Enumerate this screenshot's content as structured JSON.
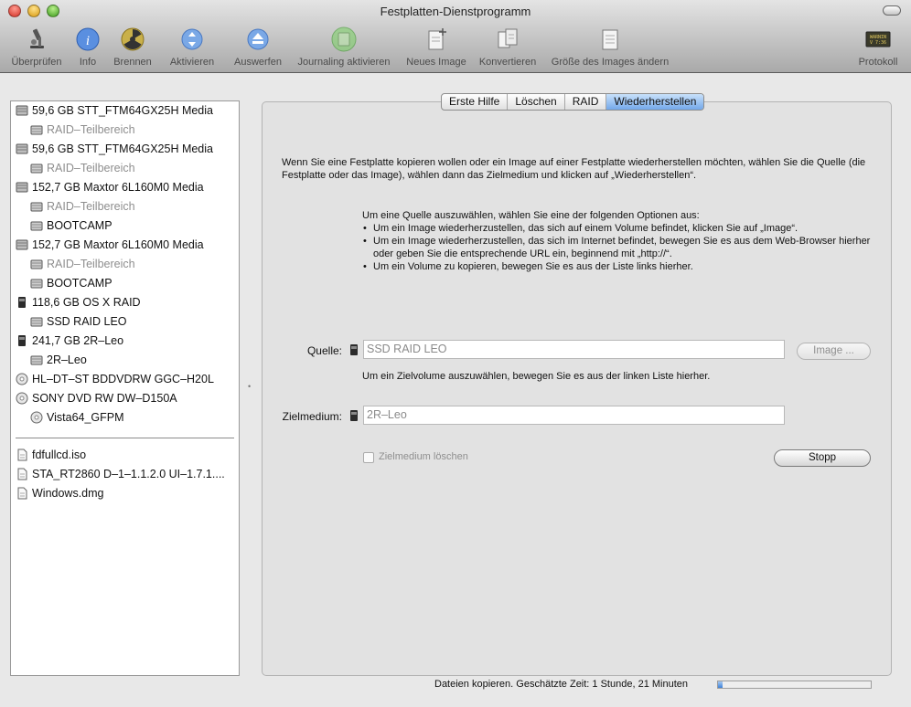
{
  "window": {
    "title": "Festplatten-Dienstprogramm"
  },
  "colors": {
    "accent": "#73a8ea",
    "window_bg": "#e8e8e8",
    "progress_fill": "#3d82d9"
  },
  "toolbar": {
    "items": [
      {
        "label": "Überprüfen",
        "icon": "microscope-icon"
      },
      {
        "label": "Info",
        "icon": "info-icon"
      },
      {
        "label": "Brennen",
        "icon": "burn-icon"
      },
      {
        "label": "Aktivieren",
        "icon": "mount-icon"
      },
      {
        "label": "Auswerfen",
        "icon": "eject-icon"
      },
      {
        "label": "Journaling aktivieren",
        "icon": "journaling-icon"
      },
      {
        "label": "Neues Image",
        "icon": "new-image-icon"
      },
      {
        "label": "Konvertieren",
        "icon": "convert-icon"
      },
      {
        "label": "Größe des Images ändern",
        "icon": "resize-image-icon"
      },
      {
        "label": "Protokoll",
        "icon": "log-icon"
      }
    ],
    "log_icon_text": "WARNIN\nV 7:36"
  },
  "sidebar": {
    "items": [
      {
        "label": "59,6 GB STT_FTM64GX25H Media",
        "icon": "disk-icon",
        "dim": false,
        "indent": 0
      },
      {
        "label": "RAID–Teilbereich",
        "icon": "volume-icon",
        "dim": true,
        "indent": 1
      },
      {
        "label": "59,6 GB STT_FTM64GX25H Media",
        "icon": "disk-icon",
        "dim": false,
        "indent": 0
      },
      {
        "label": "RAID–Teilbereich",
        "icon": "volume-icon",
        "dim": true,
        "indent": 1
      },
      {
        "label": "152,7 GB Maxtor 6L160M0 Media",
        "icon": "disk-icon",
        "dim": false,
        "indent": 0
      },
      {
        "label": "RAID–Teilbereich",
        "icon": "volume-icon",
        "dim": true,
        "indent": 1
      },
      {
        "label": "BOOTCAMP",
        "icon": "volume-icon",
        "dim": false,
        "indent": 1
      },
      {
        "label": "152,7 GB Maxtor 6L160M0 Media",
        "icon": "disk-icon",
        "dim": false,
        "indent": 0
      },
      {
        "label": "RAID–Teilbereich",
        "icon": "volume-icon",
        "dim": true,
        "indent": 1
      },
      {
        "label": "BOOTCAMP",
        "icon": "volume-icon",
        "dim": false,
        "indent": 1
      },
      {
        "label": "118,6 GB OS X RAID",
        "icon": "raid-icon",
        "dim": false,
        "indent": 0
      },
      {
        "label": "SSD RAID LEO",
        "icon": "volume-icon",
        "dim": false,
        "indent": 1
      },
      {
        "label": "241,7 GB 2R–Leo",
        "icon": "raid-icon",
        "dim": false,
        "indent": 0
      },
      {
        "label": "2R–Leo",
        "icon": "volume-icon",
        "dim": false,
        "indent": 1
      },
      {
        "label": "HL–DT–ST BDDVDRW GGC–H20L",
        "icon": "optical-icon",
        "dim": false,
        "indent": 0
      },
      {
        "label": "SONY DVD RW DW–D150A",
        "icon": "optical-icon",
        "dim": false,
        "indent": 0
      },
      {
        "label": "Vista64_GFPM",
        "icon": "optical-icon",
        "dim": false,
        "indent": 1
      }
    ],
    "images": [
      {
        "label": "fdfullcd.iso",
        "icon": "image-file-icon"
      },
      {
        "label": "STA_RT2860 D–1–1.1.2.0 UI–1.7.1....",
        "icon": "image-file-icon"
      },
      {
        "label": "Windows.dmg",
        "icon": "image-file-icon"
      }
    ]
  },
  "tabs": [
    {
      "label": "Erste Hilfe",
      "active": false
    },
    {
      "label": "Löschen",
      "active": false
    },
    {
      "label": "RAID",
      "active": false
    },
    {
      "label": "Wiederherstellen",
      "active": true
    }
  ],
  "restore": {
    "intro": "Wenn Sie eine Festplatte kopieren wollen oder ein Image auf einer Festplatte wiederherstellen möchten, wählen Sie die Quelle (die Festplatte oder das Image), wählen dann das Zielmedium und klicken auf „Wiederherstellen“.",
    "options_heading": "Um eine Quelle auszuwählen, wählen Sie eine der folgenden Optionen aus:",
    "options": [
      "Um ein Image wiederherzustellen, das sich auf einem Volume befindet, klicken Sie auf „Image“.",
      "Um ein Image wiederherzustellen, das sich im Internet befindet, bewegen Sie es aus dem Web-Browser hierher oder geben Sie die entsprechende URL ein, beginnend mit „http://“.",
      "Um ein Volume zu kopieren, bewegen Sie es aus der Liste links hierher."
    ],
    "source_label": "Quelle:",
    "source_value": "SSD RAID LEO",
    "image_button": "Image ...",
    "target_hint": "Um ein Zielvolume auszuwählen, bewegen Sie es aus der linken Liste hierher.",
    "target_label": "Zielmedium:",
    "target_value": "2R–Leo",
    "erase_checkbox_label": "Zielmedium löschen",
    "erase_checked": false,
    "stop_button": "Stopp"
  },
  "status": {
    "text": "Dateien kopieren. Geschätzte Zeit: 1 Stunde, 21 Minuten",
    "progress_fraction": 0.03
  }
}
